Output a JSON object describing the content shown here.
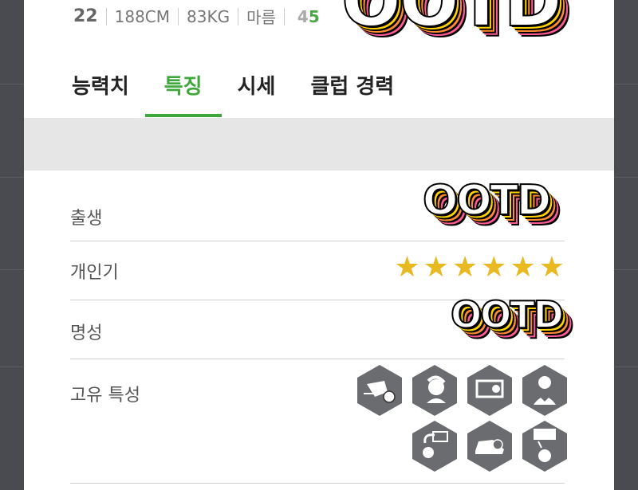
{
  "player": {
    "number": "22",
    "height": "188CM",
    "weight": "83KG",
    "body_type": "마름",
    "condition_a": "4",
    "condition_b": "5"
  },
  "tabs": [
    {
      "label": "능력치"
    },
    {
      "label": "특징"
    },
    {
      "label": "시세"
    },
    {
      "label": "클럽 경력"
    }
  ],
  "rows": {
    "birth": "출생",
    "popularity": "개인기",
    "reputation": "명성",
    "traits": "고유 특성"
  },
  "popularity_stars": 6,
  "watermark": "OOTD",
  "colors": {
    "accent": "#3fa83a",
    "star": "#e8b920",
    "hex": "#6b6c70"
  },
  "trait_icons": [
    "speed-dribble-icon",
    "header-player-icon",
    "goal-net-shot-icon",
    "heart-player-icon",
    "curve-pass-icon",
    "boot-icon",
    "flying-ball-icon"
  ]
}
